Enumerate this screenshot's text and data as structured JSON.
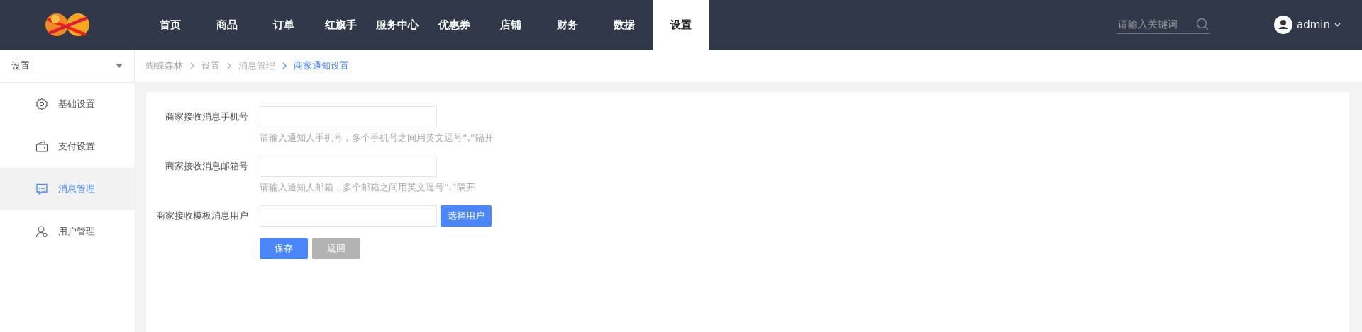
{
  "header": {
    "nav": [
      {
        "label": "首页",
        "selected": false
      },
      {
        "label": "商品",
        "selected": false
      },
      {
        "label": "订单",
        "selected": false
      },
      {
        "label": "红旗手",
        "selected": false
      },
      {
        "label": "服务中心",
        "selected": false
      },
      {
        "label": "优惠券",
        "selected": false
      },
      {
        "label": "店铺",
        "selected": false
      },
      {
        "label": "财务",
        "selected": false
      },
      {
        "label": "数据",
        "selected": false
      },
      {
        "label": "设置",
        "selected": true
      }
    ],
    "search": {
      "placeholder": "请输入关键词"
    },
    "user": "admin"
  },
  "sidebar": {
    "title": "设置",
    "items": [
      {
        "label": "基础设置",
        "selected": false
      },
      {
        "label": "支付设置",
        "selected": false
      },
      {
        "label": "消息管理",
        "selected": true
      },
      {
        "label": "用户管理",
        "selected": false
      }
    ]
  },
  "breadcrumb": [
    {
      "label": "蝴蝶森林",
      "current": false
    },
    {
      "label": "设置",
      "current": false
    },
    {
      "label": "消息管理",
      "current": false
    },
    {
      "label": "商家通知设置",
      "current": true
    }
  ],
  "form": {
    "fields": [
      {
        "label": "商家接收消息手机号",
        "hint": "请输入通知人手机号，多个手机号之间用英文逗号“,”隔开"
      },
      {
        "label": "商家接收消息邮箱号",
        "hint": "请输入通知人邮箱，多个邮箱之间用英文逗号“,”隔开"
      },
      {
        "label": "商家接收模板消息用户",
        "button": "选择用户"
      }
    ],
    "buttons": [
      {
        "label": "保存",
        "kind": "primary"
      },
      {
        "label": "返回",
        "kind": "secondary"
      }
    ]
  }
}
